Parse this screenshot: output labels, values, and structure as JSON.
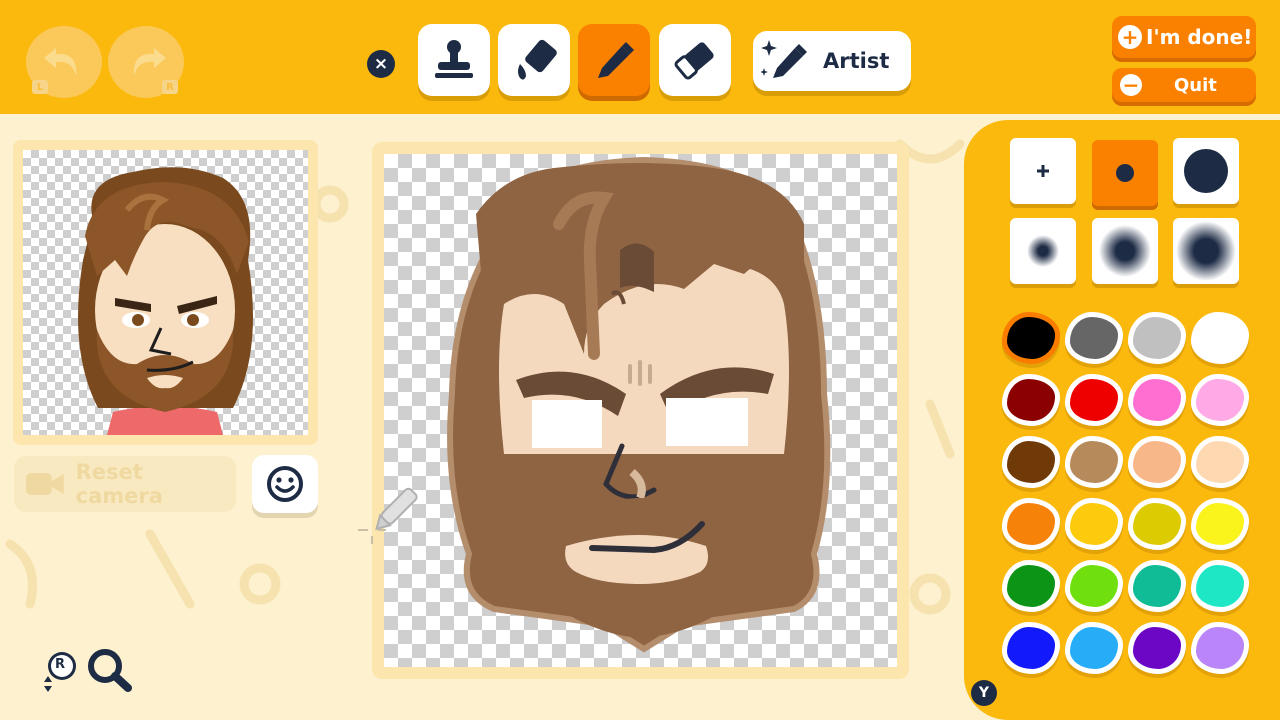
{
  "toolbar": {
    "undo_button_hint": "L",
    "redo_button_hint": "R",
    "close_glyph": "×",
    "tools": [
      {
        "name": "stamp",
        "icon": "stamp-icon"
      },
      {
        "name": "fill",
        "icon": "paint-bucket-icon"
      },
      {
        "name": "pen",
        "icon": "pen-icon",
        "active": true
      },
      {
        "name": "eraser",
        "icon": "eraser-icon"
      }
    ],
    "artist_label": "Artist"
  },
  "actions": {
    "done_icon": "+",
    "done_label": "I'm done!",
    "quit_icon": "−",
    "quit_label": "Quit"
  },
  "preview": {
    "reset_camera_label": "Reset camera",
    "zoom_hint": "R"
  },
  "palette": {
    "brush_sizes": [
      "small",
      "medium",
      "large",
      "soft-small",
      "soft-medium",
      "soft-large"
    ],
    "active_brush": "medium",
    "colors": [
      "#000000",
      "#666666",
      "#c0c0c0",
      "#ffffff",
      "#8b0000",
      "#ee0000",
      "#ff6fd2",
      "#ffaae6",
      "#703a08",
      "#b68a5a",
      "#f8b789",
      "#fdd8b0",
      "#f6820a",
      "#fccb0e",
      "#dccb00",
      "#faf31c",
      "#0c9416",
      "#6fe00e",
      "#0fbc95",
      "#1ee7c6",
      "#1219fa",
      "#27adf8",
      "#6d07c6",
      "#b985f8"
    ],
    "selected_color_index": 0,
    "y_hint": "Y"
  }
}
